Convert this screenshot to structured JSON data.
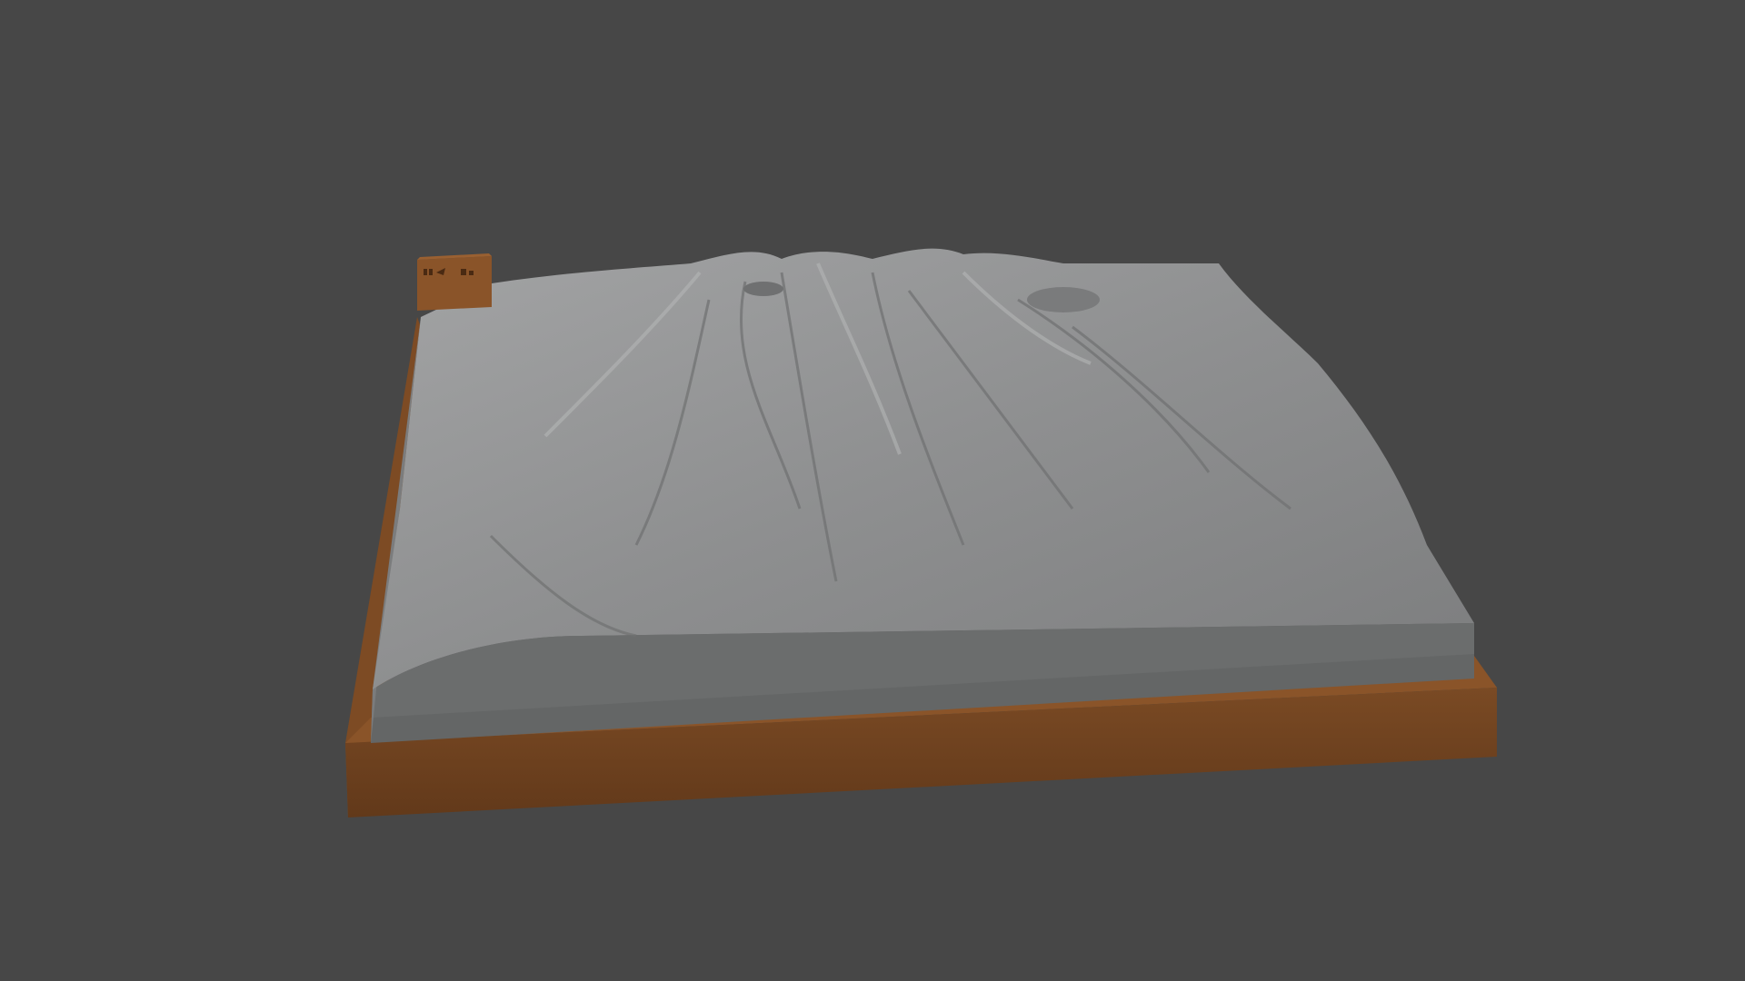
{
  "scene": {
    "background_color": "#474747",
    "base_color": "#6e4220",
    "terrain_color": "#8c8d8e",
    "slab_side_color": "#626464",
    "objects": [
      "terrain-model",
      "wooden-base",
      "label-block"
    ]
  }
}
